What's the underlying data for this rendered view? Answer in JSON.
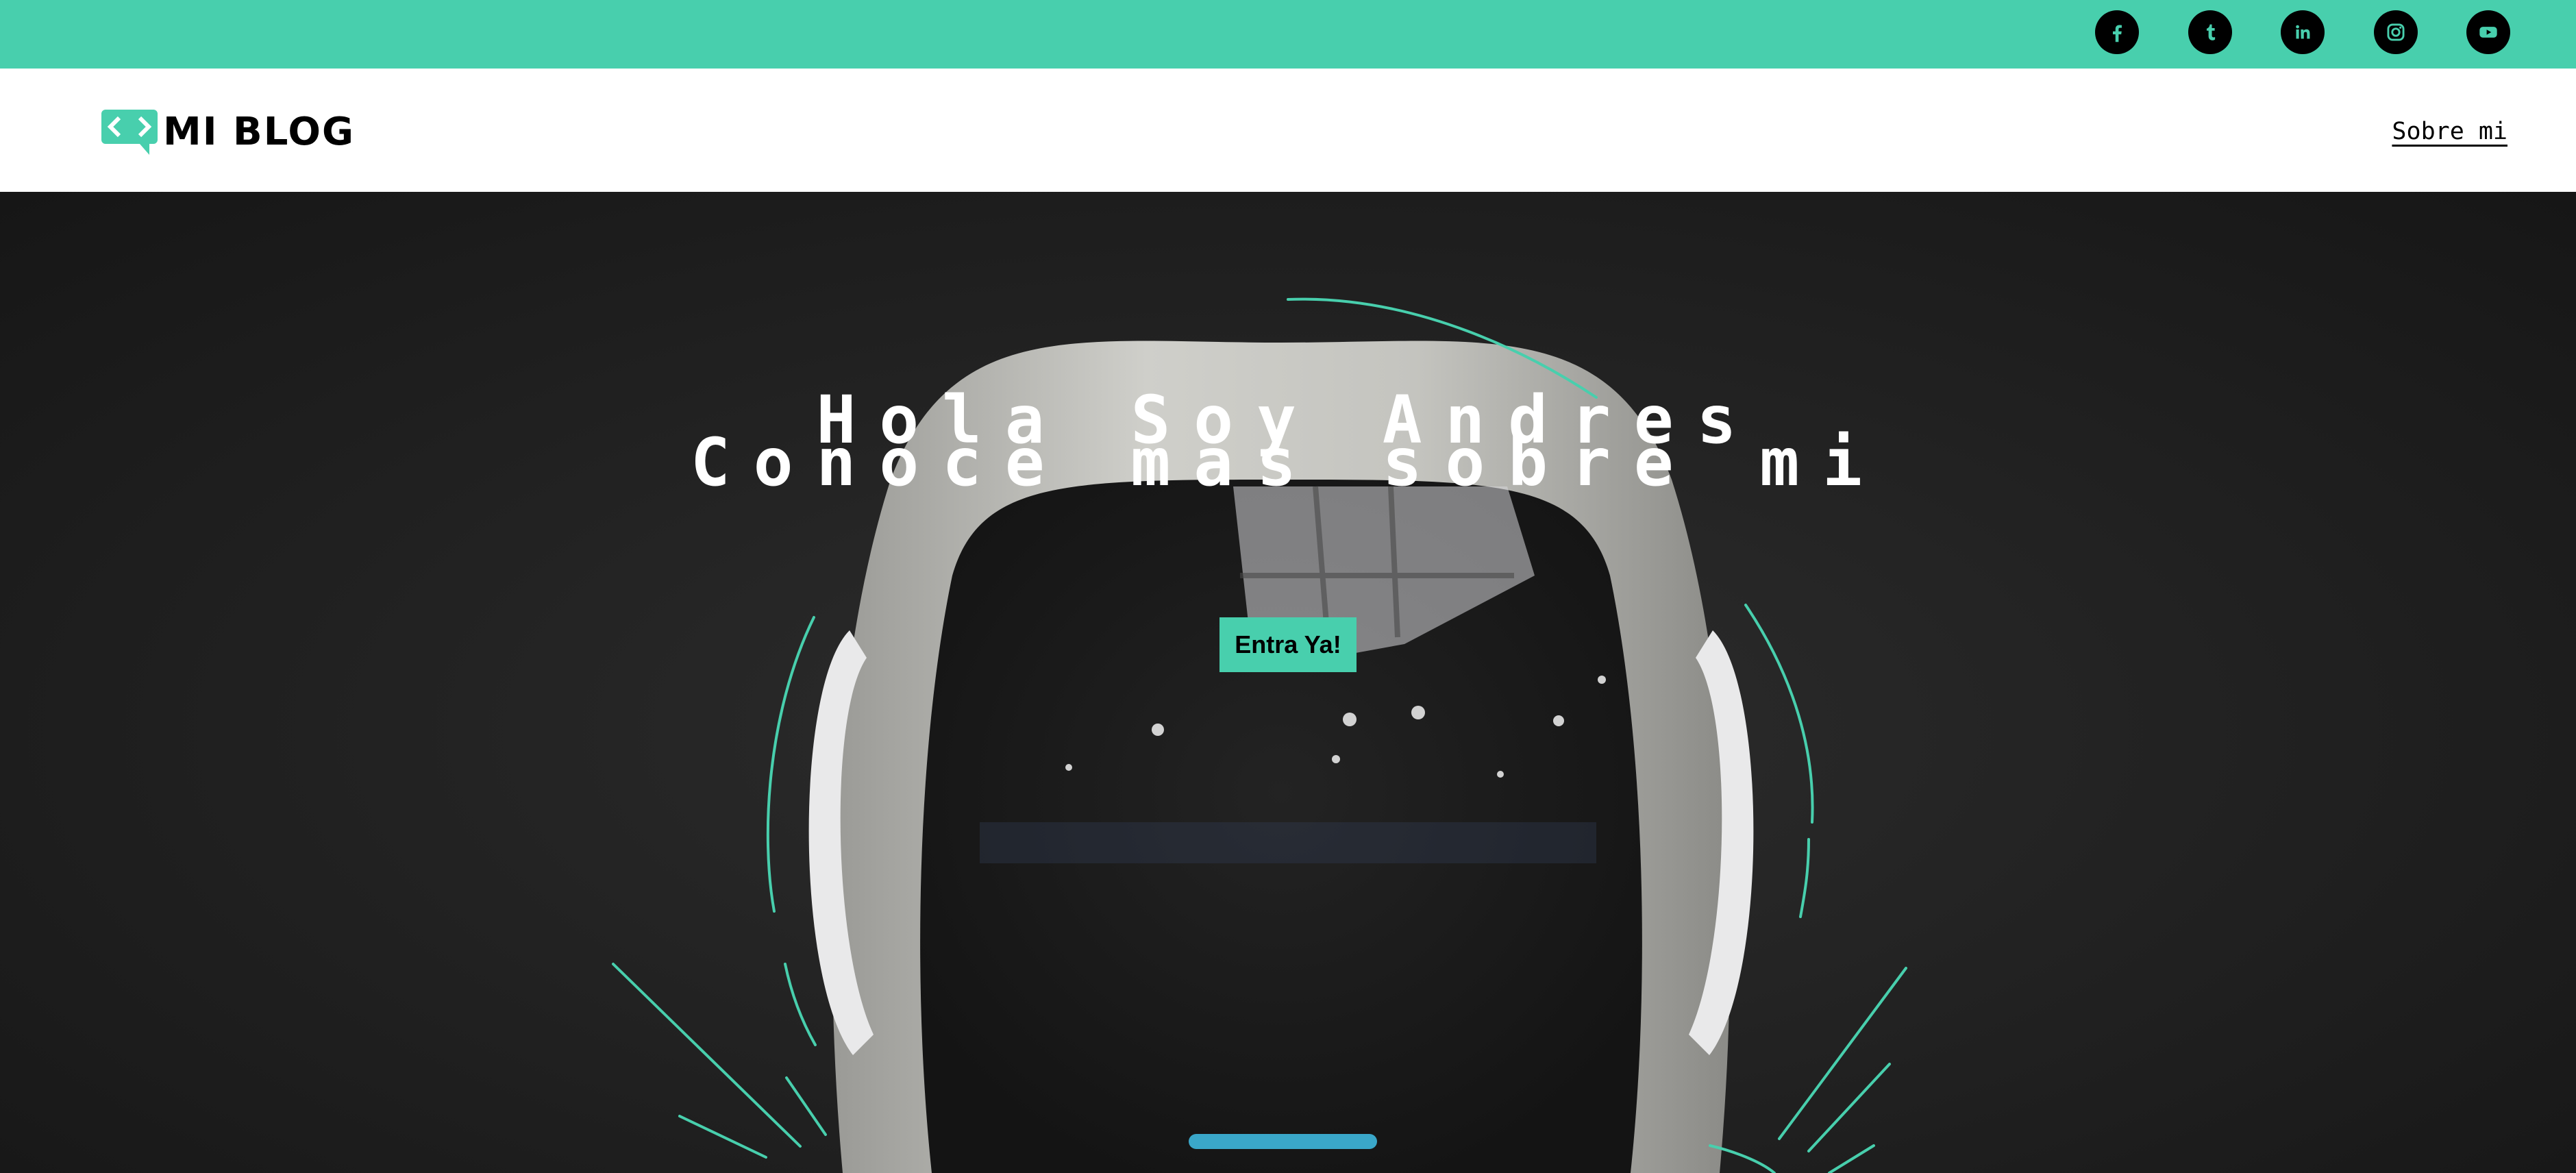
{
  "colors": {
    "accent": "#48cfad",
    "text_dark": "#000000",
    "hero_bg": "#232323",
    "hero_text": "#ffffff"
  },
  "social_links": [
    {
      "name": "facebook",
      "icon": "facebook-icon"
    },
    {
      "name": "tumblr",
      "icon": "tumblr-icon"
    },
    {
      "name": "linkedin",
      "icon": "linkedin-icon"
    },
    {
      "name": "instagram",
      "icon": "instagram-icon"
    },
    {
      "name": "youtube",
      "icon": "youtube-icon"
    }
  ],
  "header": {
    "logo_icon": "speech-bubble-code-icon",
    "logo_text": "MI BLOG",
    "nav": [
      {
        "label": "Sobre mi"
      }
    ]
  },
  "hero": {
    "title": "Hola Soy Andres",
    "subtitle": "Conoce mas sobre mi",
    "cta_label": "Entra Ya!",
    "background_image": "astronaut-helmet-photo"
  }
}
